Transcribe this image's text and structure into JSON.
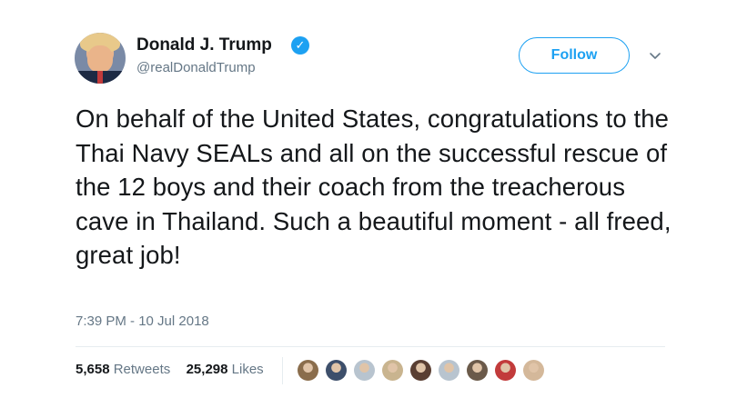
{
  "tweet": {
    "author": {
      "name": "Donald J. Trump",
      "handle": "@realDonaldTrump",
      "verified_icon": "✓"
    },
    "follow_label": "Follow",
    "text": "On behalf of the United States, congratulations to the Thai Navy SEALs and all on the successful rescue of the 12 boys and their coach from the treacherous cave in Thailand. Such a beautiful moment - all freed, great job!",
    "timestamp": "7:39 PM - 10 Jul 2018",
    "stats": {
      "retweets_count": "5,658",
      "retweets_label": "Retweets",
      "likes_count": "25,298",
      "likes_label": "Likes"
    },
    "liker_avatars": [
      {
        "color": "#8a6d4c"
      },
      {
        "color": "#3d4f6b"
      },
      {
        "color": "#b8c4cf"
      },
      {
        "color": "#c9b48f"
      },
      {
        "color": "#5a3f33"
      },
      {
        "color": "#b8c4cf"
      },
      {
        "color": "#6b5a4a"
      },
      {
        "color": "#c23b3b"
      },
      {
        "color": "#d4b89a"
      }
    ]
  },
  "colors": {
    "accent": "#1da1f2",
    "secondary_text": "#657786",
    "primary_text": "#14171a"
  }
}
